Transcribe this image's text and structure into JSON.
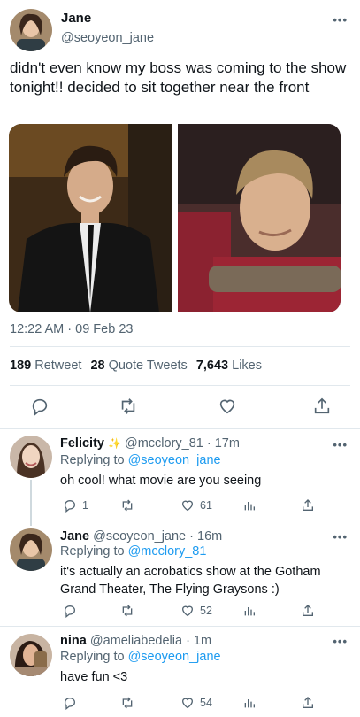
{
  "main_tweet": {
    "name": "Jane",
    "handle": "@seoyeon_jane",
    "text": "didn't even know my boss was coming to the show tonight!! decided to sit together near the front",
    "timestamp": "12:22 AM · 09 Feb 23",
    "stats": {
      "retweets_count": "189",
      "retweets_label": "Retweet",
      "quotes_count": "28",
      "quotes_label": "Quote Tweets",
      "likes_count": "7,643",
      "likes_label": "Likes"
    },
    "more_icon": "more-dots-icon"
  },
  "replies": [
    {
      "name": "Felicity",
      "badge": "✨",
      "handle": "@mcclory_81",
      "time": "· 17m",
      "replying_prefix": "Replying to",
      "replying_to": "@seoyeon_jane",
      "text": "oh cool! what movie are you seeing",
      "reply_count": "1",
      "retweet_count": "",
      "like_count": "61"
    },
    {
      "name": "Jane",
      "handle": "@seoyeon_jane",
      "time": "· 16m",
      "replying_prefix": "Replying to",
      "replying_to": "@mcclory_81",
      "text": "it's actually an acrobatics show at the Gotham Grand Theater, The Flying Graysons :)",
      "reply_count": "",
      "retweet_count": "",
      "like_count": "52"
    },
    {
      "name": "nina",
      "handle": "@ameliabedelia",
      "time": "· 1m",
      "replying_prefix": "Replying to",
      "replying_to": "@seoyeon_jane",
      "text": "have fun <3",
      "reply_count": "",
      "retweet_count": "",
      "like_count": "54"
    }
  ],
  "icons": {
    "reply": "reply-icon",
    "retweet": "retweet-icon",
    "like": "heart-icon",
    "share": "share-icon",
    "analytics": "analytics-icon"
  },
  "colors": {
    "link": "#1d9bf0",
    "secondary_text": "#536471",
    "primary_text": "#0f1419",
    "divider": "#e1e8ed"
  }
}
